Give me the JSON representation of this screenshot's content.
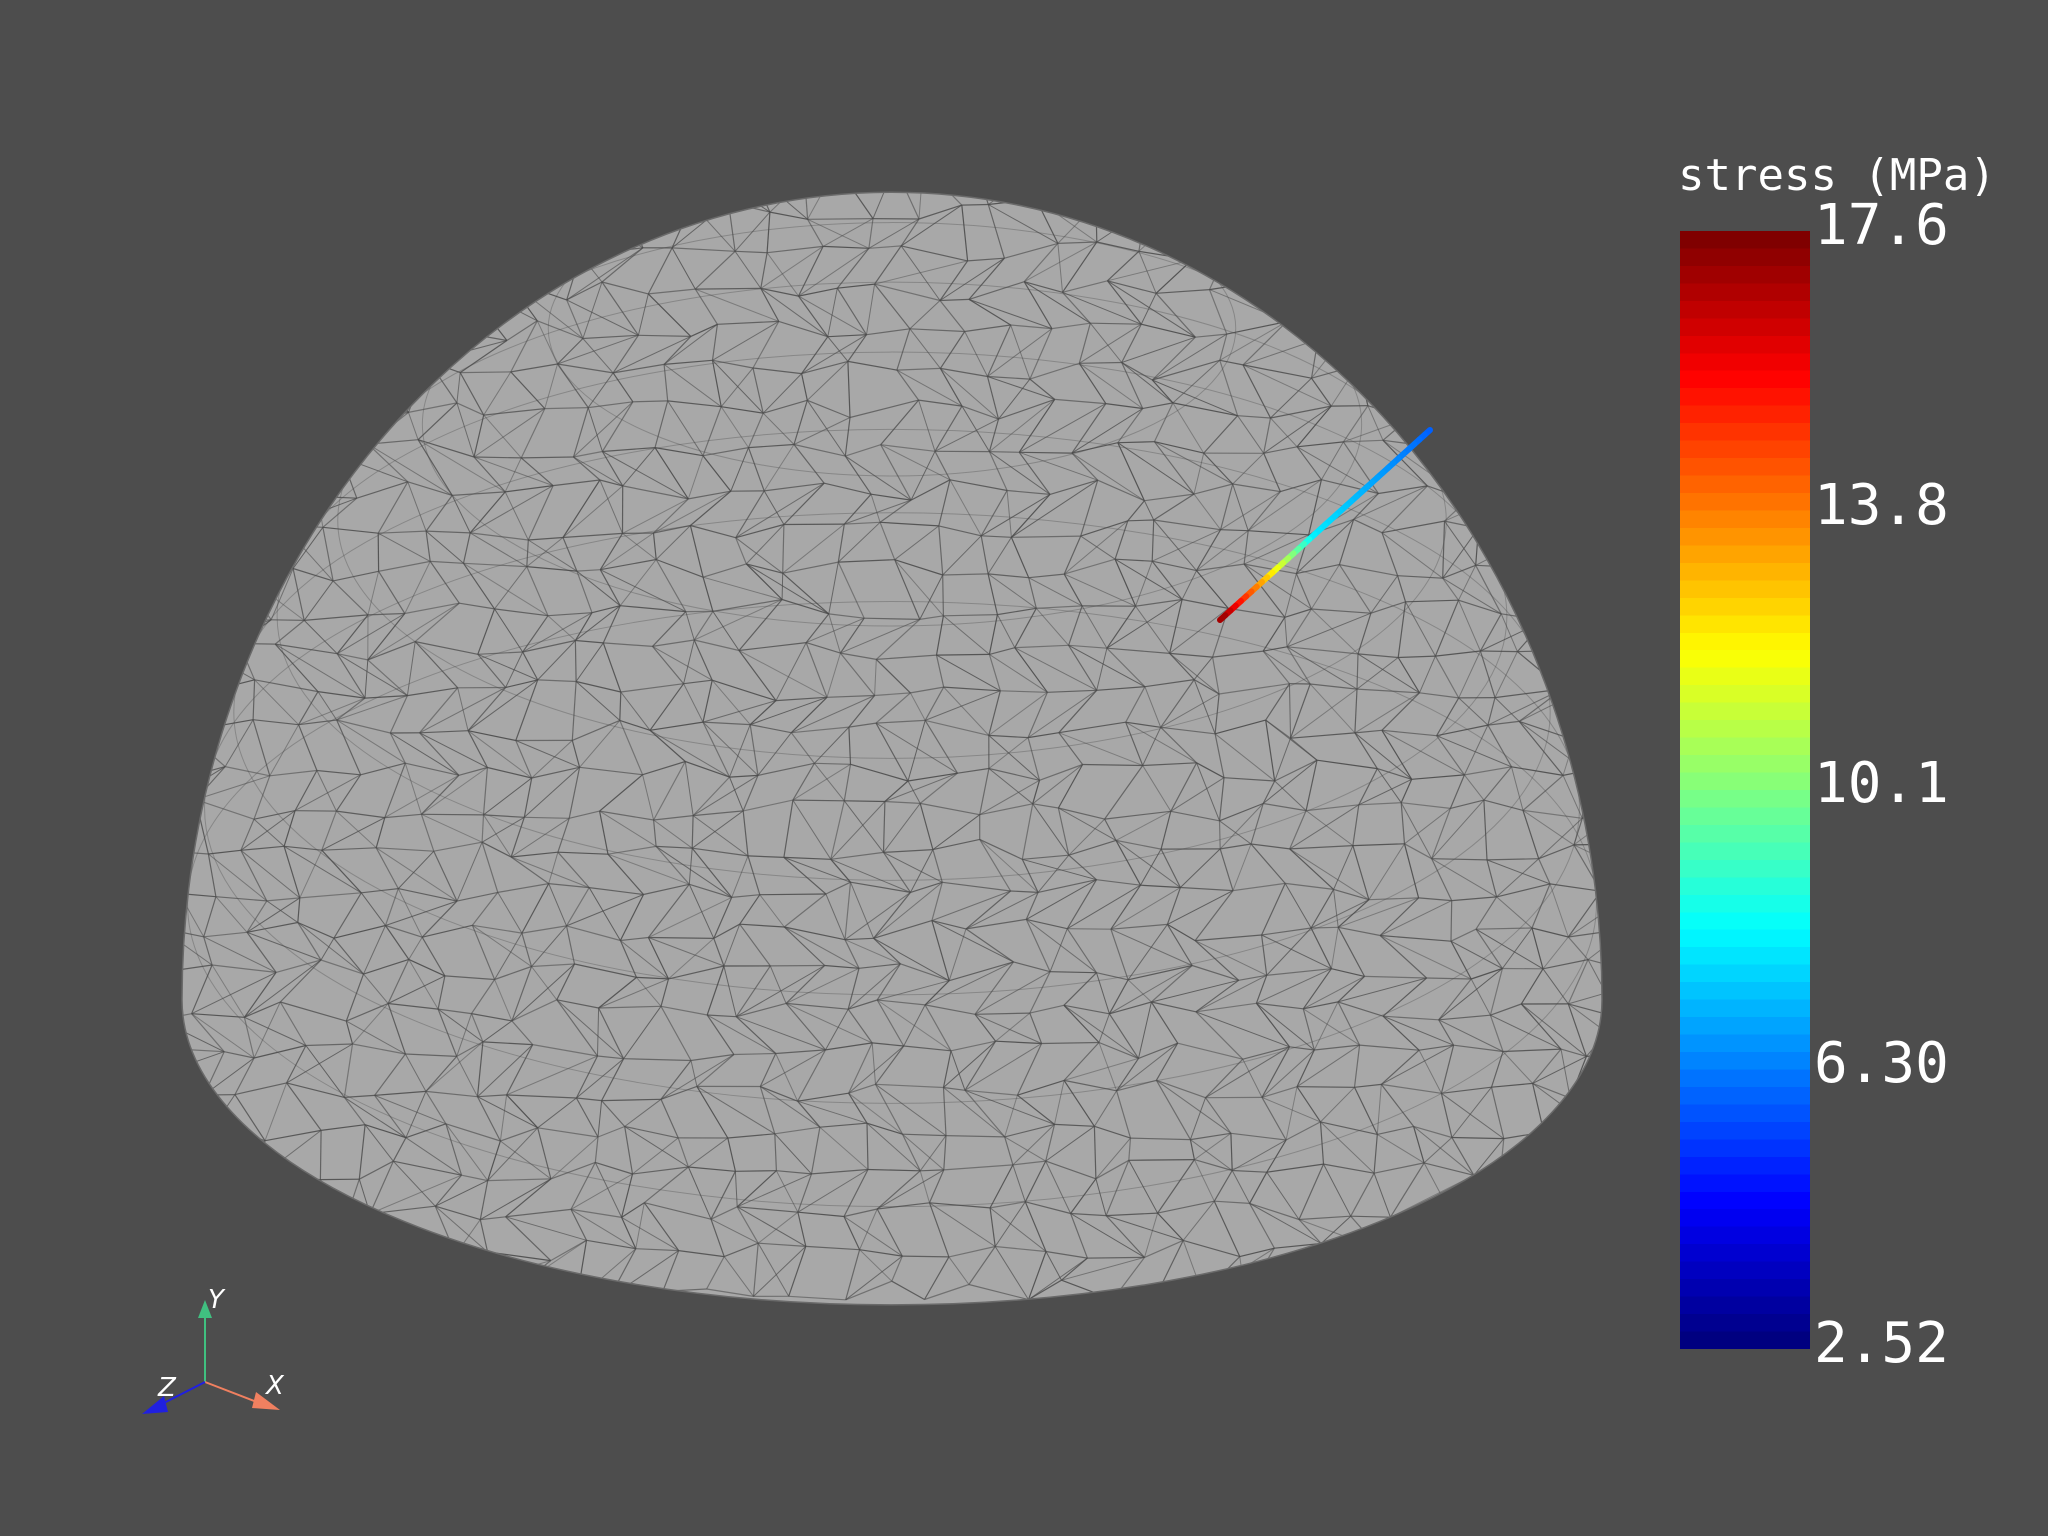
{
  "scene": {
    "object": "hemisphere-mesh",
    "surface_color": "#a8a8a8",
    "edge_color": "#4a4a4a",
    "background": "#4d4d4d"
  },
  "colorbar": {
    "title": "stress (MPa)",
    "colormap": "jet",
    "min": 2.52,
    "max": 17.6,
    "tick_labels": [
      "17.6",
      "13.8",
      "10.1",
      "6.30",
      "2.52"
    ]
  },
  "axes_widget": {
    "x_label": "X",
    "y_label": "Y",
    "z_label": "Z",
    "x_color": "#f08060",
    "y_color": "#40c080",
    "z_color": "#2020e0"
  }
}
